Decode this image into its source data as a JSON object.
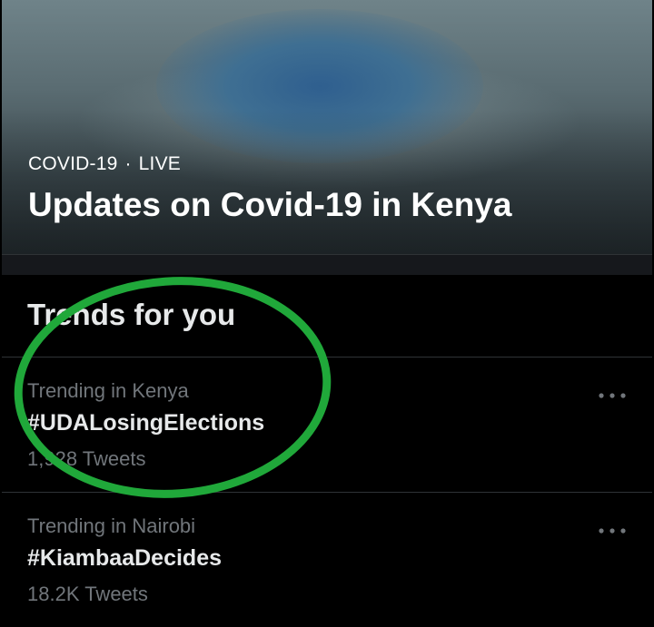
{
  "hero": {
    "category": "COVID-19",
    "separator": "·",
    "status": "LIVE",
    "title": "Updates on Covid-19 in Kenya"
  },
  "trends_section": {
    "title": "Trends for you"
  },
  "trends": [
    {
      "context": "Trending in Kenya",
      "name": "#UDALosingElections",
      "count": "1,928 Tweets"
    },
    {
      "context": "Trending in Nairobi",
      "name": "#KiambaaDecides",
      "count": "18.2K Tweets"
    }
  ],
  "icons": {
    "more": "more-horizontal-icon"
  },
  "colors": {
    "background": "#000000",
    "primary_text": "#e7e9ea",
    "secondary_text": "#71767b",
    "divider": "#2f3336",
    "annotation_circle": "#20a83a"
  }
}
